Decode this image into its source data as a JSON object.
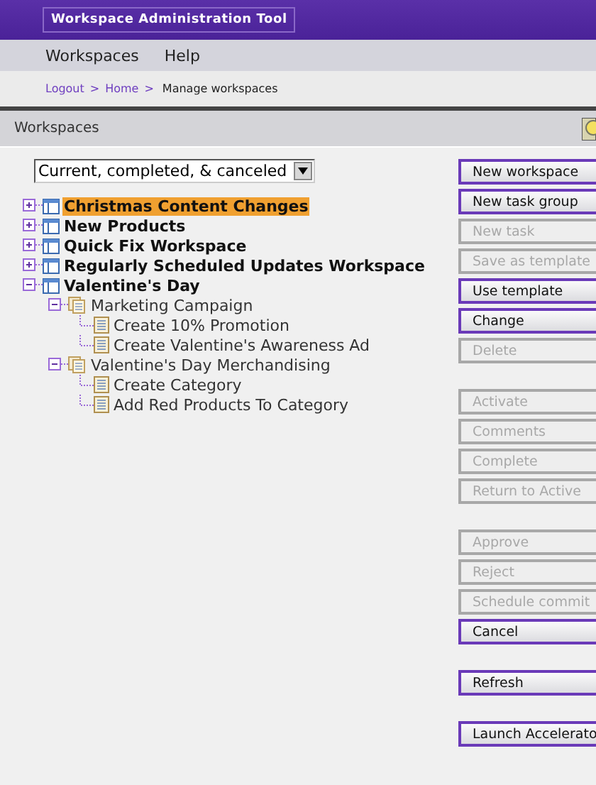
{
  "window": {
    "title": "Workspace Administration Tool"
  },
  "menu": [
    {
      "label": "Workspaces"
    },
    {
      "label": "Help"
    }
  ],
  "breadcrumb": {
    "links": [
      "Logout",
      "Home"
    ],
    "separator": ">",
    "current": "Manage workspaces"
  },
  "section": {
    "title": "Workspaces"
  },
  "filter": {
    "value": "Current, completed, & canceled"
  },
  "tree": [
    {
      "label": "Christmas Content Changes",
      "kind": "workspace",
      "expanded": false,
      "selected": true
    },
    {
      "label": "New Products",
      "kind": "workspace",
      "expanded": false,
      "selected": false
    },
    {
      "label": "Quick Fix Workspace",
      "kind": "workspace",
      "expanded": false,
      "selected": false
    },
    {
      "label": "Regularly Scheduled Updates Workspace",
      "kind": "workspace",
      "expanded": false,
      "selected": false
    },
    {
      "label": "Valentine's Day",
      "kind": "workspace",
      "expanded": true,
      "selected": false,
      "children": [
        {
          "label": "Marketing Campaign",
          "kind": "group",
          "expanded": true,
          "selected": false,
          "children": [
            {
              "label": "Create 10% Promotion",
              "kind": "task",
              "selected": false
            },
            {
              "label": "Create Valentine's Awareness Ad",
              "kind": "task",
              "selected": false
            }
          ]
        },
        {
          "label": "Valentine's Day Merchandising",
          "kind": "group",
          "expanded": true,
          "selected": false,
          "children": [
            {
              "label": "Create Category",
              "kind": "task",
              "selected": false
            },
            {
              "label": "Add Red Products To Category",
              "kind": "task",
              "selected": false
            }
          ]
        }
      ]
    }
  ],
  "button_groups": [
    [
      {
        "label": "New workspace",
        "disabled": false
      },
      {
        "label": "New task group",
        "disabled": false
      },
      {
        "label": "New task",
        "disabled": true
      },
      {
        "label": "Save as template",
        "disabled": true
      },
      {
        "label": "Use template",
        "disabled": false
      },
      {
        "label": "Change",
        "disabled": false
      },
      {
        "label": "Delete",
        "disabled": true
      }
    ],
    [
      {
        "label": "Activate",
        "disabled": true
      },
      {
        "label": "Comments",
        "disabled": true
      },
      {
        "label": "Complete",
        "disabled": true
      },
      {
        "label": "Return to Active",
        "disabled": true
      }
    ],
    [
      {
        "label": "Approve",
        "disabled": true
      },
      {
        "label": "Reject",
        "disabled": true
      },
      {
        "label": "Schedule commit",
        "disabled": true
      },
      {
        "label": "Cancel",
        "disabled": false
      }
    ],
    [
      {
        "label": "Refresh",
        "disabled": false
      }
    ],
    [
      {
        "label": "Launch Accelerato",
        "disabled": false
      }
    ]
  ]
}
